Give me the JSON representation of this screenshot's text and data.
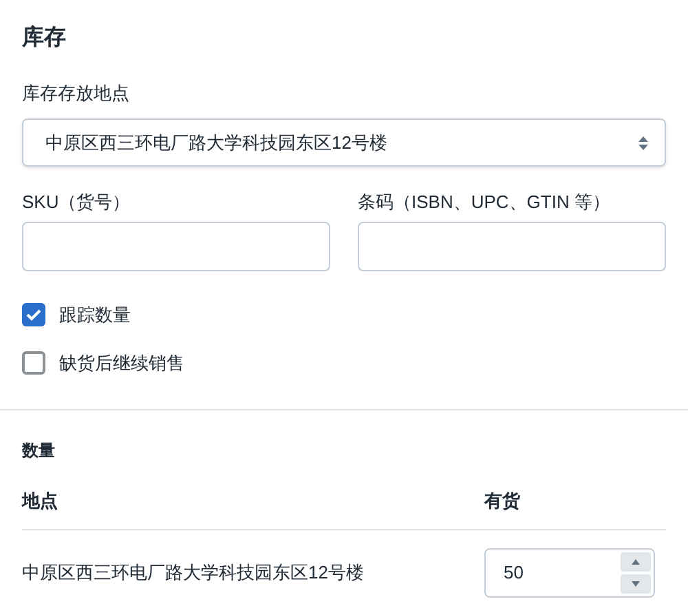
{
  "title": "库存",
  "location_field": {
    "label": "库存存放地点",
    "value": "中原区西三环电厂路大学科技园东区12号楼"
  },
  "sku_field": {
    "label": "SKU（货号）"
  },
  "barcode_field": {
    "label": "条码（ISBN、UPC、GTIN 等）"
  },
  "options": [
    {
      "label": "跟踪数量",
      "checked": true
    },
    {
      "label": "缺货后继续销售",
      "checked": false
    }
  ],
  "quantity": {
    "title": "数量",
    "columns": [
      "地点",
      "有货"
    ],
    "rows": [
      {
        "location": "中原区西三环电厂路大学科技园东区12号楼",
        "available": "50"
      }
    ]
  }
}
